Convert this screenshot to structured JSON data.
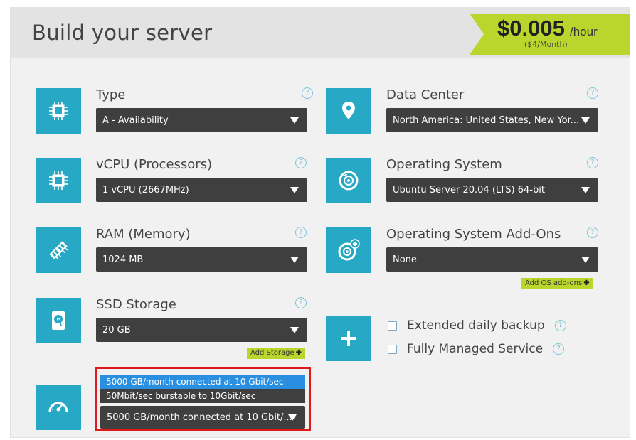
{
  "header": {
    "title": "Build your server",
    "price": "$0.005",
    "price_unit": "/hour",
    "price_monthly": "($4/Month)"
  },
  "fields": {
    "type": {
      "label": "Type",
      "value": "A - Availability",
      "icon": "chip-icon"
    },
    "vcpu": {
      "label": "vCPU (Processors)",
      "value": "1 vCPU (2667MHz)",
      "icon": "chip-icon"
    },
    "ram": {
      "label": "RAM (Memory)",
      "value": "1024 MB",
      "icon": "memory-icon"
    },
    "ssd": {
      "label": "SSD Storage",
      "value": "20 GB",
      "icon": "disk-icon",
      "add_label": "Add Storage"
    },
    "datacenter": {
      "label": "Data Center",
      "value": "North America: United States, New Yor...",
      "icon": "location-pin-icon"
    },
    "os": {
      "label": "Operating System",
      "value": "Ubuntu Server 20.04 (LTS) 64-bit",
      "icon": "cd-icon"
    },
    "os_addons": {
      "label": "Operating System Add-Ons",
      "value": "None",
      "icon": "cd-plus-icon",
      "add_label": "Add OS add-ons"
    }
  },
  "extras": {
    "backup_label": "Extended daily backup",
    "managed_label": "Fully Managed Service",
    "icon": "plus-icon"
  },
  "bandwidth": {
    "icon": "speedometer-icon",
    "options": [
      "5000 GB/month connected at 10 Gbit/sec",
      "50Mbit/sec burstable to 10Gbit/sec"
    ],
    "value": "5000 GB/month connected at 10 Gbit/..."
  },
  "colors": {
    "accent": "#27a8c5",
    "green": "#bad62d",
    "select_bg": "#3f3f3f",
    "highlight": "#e01a1a",
    "option_selected": "#2a8fe0"
  }
}
